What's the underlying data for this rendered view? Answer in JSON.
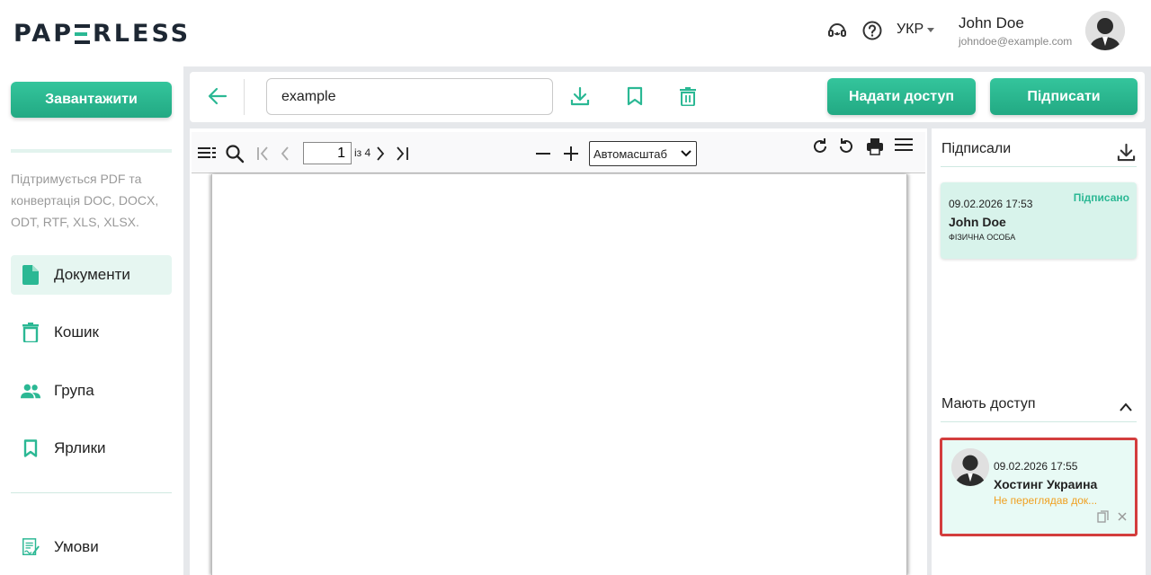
{
  "header": {
    "logo": "PAPERLESS",
    "logo_left": "PAP",
    "logo_right": "RLESS",
    "language": "УКР",
    "user_name": "John Doe",
    "user_email": "johndoe@example.com"
  },
  "sidebar": {
    "upload_label": "Завантажити",
    "note": "Підтримується PDF та конвертація DOC, DOCX, ODT, RTF, XLS, XLSX.",
    "items": [
      {
        "label": "Документи",
        "icon": "document-icon",
        "active": true
      },
      {
        "label": "Кошик",
        "icon": "trash-icon",
        "active": false
      },
      {
        "label": "Група",
        "icon": "group-icon",
        "active": false
      },
      {
        "label": "Ярлики",
        "icon": "bookmark-icon",
        "active": false
      }
    ],
    "terms_label": "Умови"
  },
  "toolbar": {
    "document_name": "example",
    "share_label": "Надати доступ",
    "sign_label": "Підписати"
  },
  "viewer": {
    "current_page": "1",
    "page_total_label": "із 4",
    "scale": "Автомасштаб"
  },
  "right_panel": {
    "signed_title": "Підписали",
    "signed": {
      "date": "09.02.2026 17:53",
      "status": "Підписано",
      "name": "John Doe",
      "type": "ФІЗИЧНА ОСОБА"
    },
    "access_title": "Мають доступ",
    "access": {
      "date": "09.02.2026 17:55",
      "name": "Хостинг Украина",
      "status": "Не переглядав док..."
    }
  },
  "colors": {
    "accent": "#2bb894",
    "brand_dark": "#1d2733",
    "warning": "#f0a020",
    "highlight_border": "#d33d3d"
  }
}
